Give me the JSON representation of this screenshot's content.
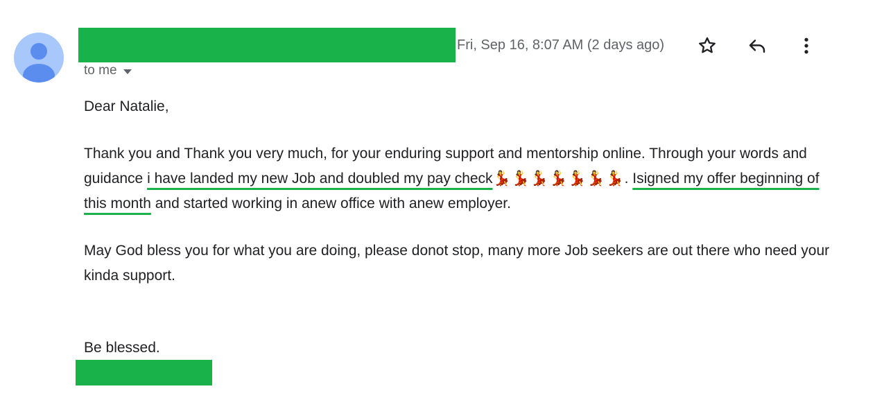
{
  "header": {
    "timestamp": "Fri, Sep 16, 8:07 AM (2 days ago)",
    "recipient_label": "to me"
  },
  "icons": {
    "avatar": "person-avatar-icon",
    "star": "star-outline-icon",
    "reply": "reply-arrow-icon",
    "more": "more-vertical-icon",
    "recipient_toggle": "caret-down-icon",
    "avatar_color": "#a8c7fa",
    "avatar_figure_color": "#5b8def",
    "redaction_color": "#19b24a"
  },
  "message": {
    "greeting": "Dear Natalie,",
    "para1_part1": "Thank you and Thank you very much, for your enduring support and mentorship online. Through your words and guidance ",
    "para1_highlight1": "i have landed my new Job and doubled my pay check",
    "para1_emojis": "💃💃💃💃💃💃💃",
    "para1_part2": ". ",
    "para1_highlight2": "Isigned my offer beginning of this month",
    "para1_part3": " and started working in anew office with anew employer.",
    "para2": "May God bless you for what you are doing, please donot stop, many more Job seekers are out there who need your kinda support.",
    "closing": "Be blessed."
  }
}
